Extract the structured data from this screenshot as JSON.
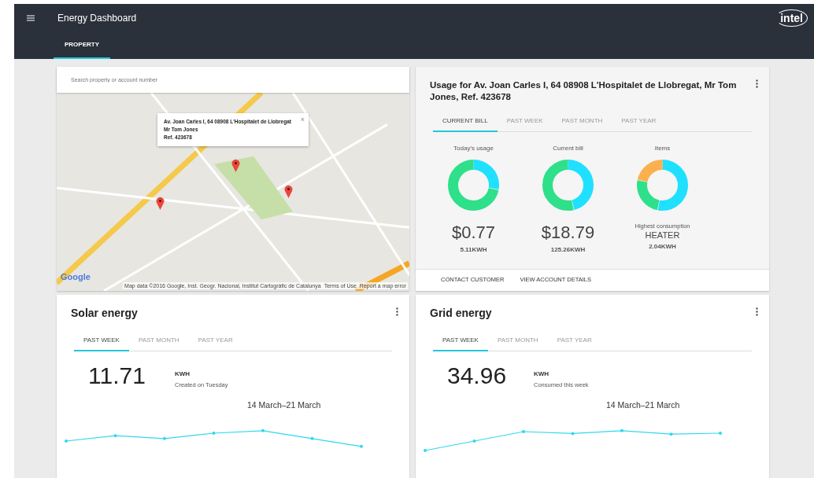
{
  "app_bar": {
    "title": "Energy Dashboard",
    "logo": "intel",
    "tabs": [
      {
        "label": "PROPERTY",
        "selected": true
      }
    ]
  },
  "map_card": {
    "search": {
      "placeholder": "Search property or account number"
    },
    "info_window": {
      "lines": [
        "Av. Joan Carles I, 64 08908 L'Hospitalet de Llobregat",
        "Mr Tom Jones",
        "Ref. 423678"
      ],
      "close": "×"
    },
    "attribution": {
      "logo": "Google",
      "data": "Map data ©2016 Google, Inst. Geogr. Nacional, Institut Cartogràfic de Catalunya",
      "links": [
        "Terms of Use",
        "Report a map error"
      ]
    }
  },
  "usage_card": {
    "title": "Usage for Av. Joan Carles I, 64 08908 L'Hospitalet de Llobregat, Mr Tom Jones, Ref. 423678",
    "tabs": [
      {
        "label": "CURRENT BILL",
        "selected": true
      },
      {
        "label": "PAST WEEK",
        "selected": false
      },
      {
        "label": "PAST MONTH",
        "selected": false
      },
      {
        "label": "PAST YEAR",
        "selected": false
      }
    ],
    "stats": [
      {
        "title": "Today's usage",
        "value": "$0.77",
        "reading": "5.11KWH"
      },
      {
        "title": "Current bill",
        "value": "$18.79",
        "reading": "125.26KWH"
      },
      {
        "title": "Items",
        "caption": "Highest consumption",
        "value": "HEATER",
        "reading": "2.04KWH"
      }
    ],
    "actions": [
      "CONTACT CUSTOMER",
      "VIEW ACCOUNT DETAILS"
    ]
  },
  "energy_cards": [
    {
      "title": "Solar energy",
      "tabs": [
        {
          "label": "PAST WEEK",
          "selected": true
        },
        {
          "label": "PAST MONTH",
          "selected": false
        },
        {
          "label": "PAST YEAR",
          "selected": false
        }
      ],
      "value": "11.71",
      "unit": "KWH",
      "note": "Created on Tuesday",
      "range": "14 March–21 March"
    },
    {
      "title": "Grid energy",
      "tabs": [
        {
          "label": "PAST WEEK",
          "selected": true
        },
        {
          "label": "PAST MONTH",
          "selected": false
        },
        {
          "label": "PAST YEAR",
          "selected": false
        }
      ],
      "value": "34.96",
      "unit": "KWH",
      "note": "Consumed this week",
      "range": "14 March–21 March"
    }
  ]
}
